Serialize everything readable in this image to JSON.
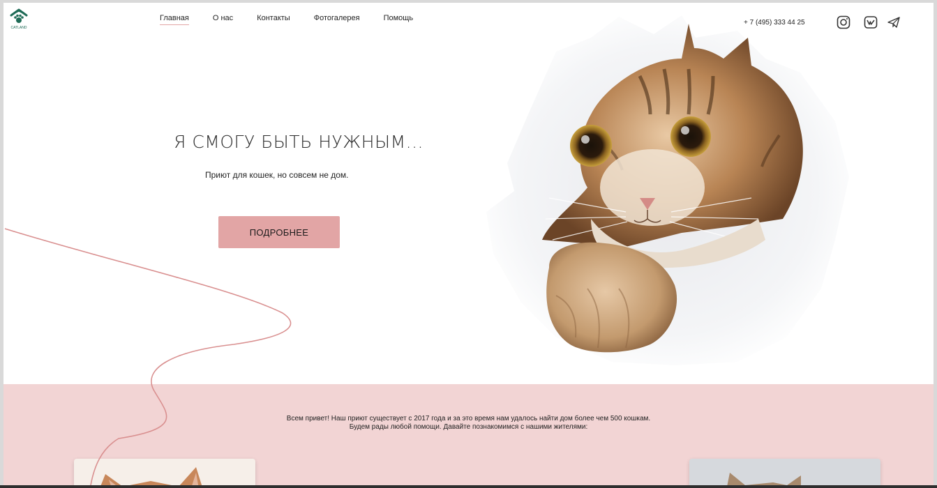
{
  "header": {
    "logo_text": "CATLAND",
    "nav": [
      {
        "label": "Главная",
        "active": true
      },
      {
        "label": "О нас",
        "active": false
      },
      {
        "label": "Контакты",
        "active": false
      },
      {
        "label": "Фотогалерея",
        "active": false
      },
      {
        "label": "Помощь",
        "active": false
      }
    ],
    "phone": "+ 7 (495) 333 44 25",
    "social_icons": [
      "instagram-icon",
      "vk-icon",
      "telegram-icon"
    ]
  },
  "hero": {
    "title": "Я СМОГУ БЫТЬ НУЖНЫМ...",
    "subtitle": "Приют для кошек, но совсем не дом.",
    "button_label": "ПОДРОБНЕЕ"
  },
  "about": {
    "line1": "Всем привет! Наш приют существует с 2017 года и за это время нам удалось найти дом более чем 500 кошкам.",
    "line2": "Будем рады любой помощи. Давайте познакомимся с нашими жителями:"
  },
  "colors": {
    "accent_pink": "#e2a5a5",
    "section_pink": "#f2d4d4",
    "logo_green": "#1f6b57"
  }
}
